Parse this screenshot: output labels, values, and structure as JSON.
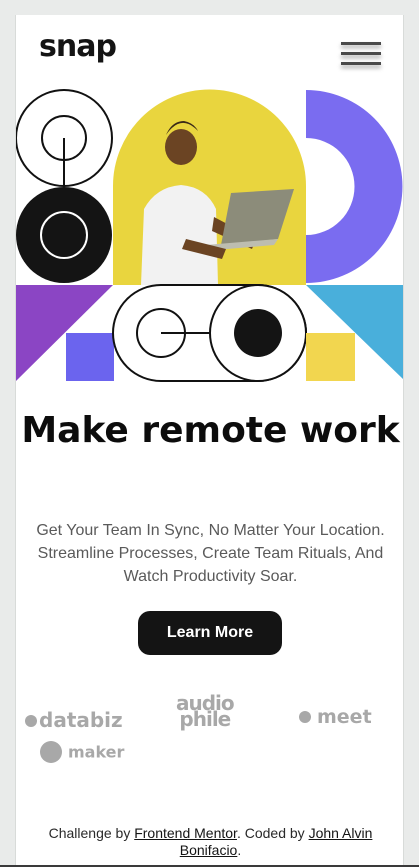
{
  "header": {
    "logo": "snap",
    "menu_icon": "hamburger-menu-icon"
  },
  "hero": {
    "title": "Make remote work",
    "subtitle": "Get Your Team In Sync, No Matter Your Location. Streamline Processes, Create Team Rituals, And Watch Productivity Soar.",
    "cta_label": "Learn More"
  },
  "clients": [
    {
      "name": "databiz",
      "icon": "databiz-logo-icon"
    },
    {
      "name": "audiophile",
      "line1": "audio",
      "line2": "phile",
      "icon": "audiophile-logo-icon"
    },
    {
      "name": "meet",
      "icon": "meet-logo-icon"
    },
    {
      "name": "maker",
      "icon": "maker-logo-icon"
    }
  ],
  "footer": {
    "prefix": "Challenge by",
    "link1": "Frontend Mentor",
    "middle": ". Coded by",
    "link2": "John Alvin Bonifacio",
    "suffix": "."
  },
  "colors": {
    "yellow": "#F2D64F",
    "purple": "#7A6CF0",
    "violet": "#8B45C4",
    "sky": "#49AFDB",
    "black": "#141414"
  }
}
